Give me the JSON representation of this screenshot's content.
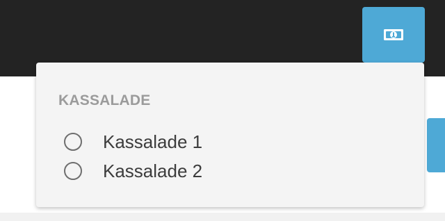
{
  "toolbar": {
    "cash_button_icon": "cash-register-icon",
    "accent_color": "#4ea9d6"
  },
  "dropdown": {
    "title": "KASSALADE",
    "options": [
      {
        "label": "Kassalade 1",
        "selected": false
      },
      {
        "label": "Kassalade 2",
        "selected": false
      }
    ]
  }
}
